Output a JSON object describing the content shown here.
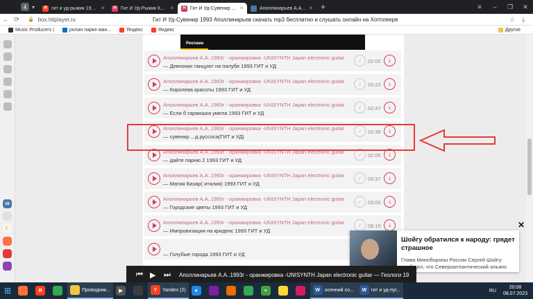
{
  "browser": {
    "tab_count": "4",
    "tabs": [
      {
        "label": "гит и уд-рыжик 1993 аппо",
        "fav_color": "#fc3f1d",
        "fav_text": "Я"
      },
      {
        "label": "Гит И Уд-Рыжик Классно",
        "fav_color": "#d43c5c",
        "fav_text": "H"
      },
      {
        "label": "Гит И Уд-Сувенир 1993",
        "fav_color": "#d43c5c",
        "fav_text": "H",
        "active": true
      },
      {
        "label": "Аполлинарьев А.А..1993г",
        "fav_color": "#4a76a8",
        "fav_text": ""
      }
    ],
    "url": "box.hitplayer.ru",
    "page_title": "Гит И Уд-Сувенир 1993 Аполлинарьев скачать mp3 бесплатно и слушать онлайн на Хотплеере",
    "bookmarks": [
      {
        "label": "Music Producers |",
        "color": "#333333"
      },
      {
        "label": "ролан парке ман...",
        "color": "#0070c0"
      },
      {
        "label": "Яндекс",
        "color": "#fc3f1d"
      },
      {
        "label": "Яндекс",
        "color": "#fc3f1d"
      }
    ],
    "bookmarks_other": "Другое"
  },
  "ad": {
    "label": "Реклама"
  },
  "tracks": [
    {
      "artist": "Аполлинарьев А.А..1993г - оранжировка -UNISYNTH Japan electronic guitar",
      "title": "— Девчонки танцуют на палубе 1993 ГИТ и УД",
      "duration": "02:00"
    },
    {
      "artist": "Аполлинарьев А.А..1993г - оранжировка -UNISYNTH Japan electronic guitar",
      "title": "— Королева красоты 1993 ГИТ и УД",
      "duration": "03:22"
    },
    {
      "artist": "Аполлинарьев А.А..1993г - оранжировка -UNISYNTH Japan electronic guitar",
      "title": "— Если б гармошка умела 1993 ГИТ и УД",
      "duration": "02:47"
    },
    {
      "artist": "Аполлинарьев А.А..1993г - оранжировка -UNISYNTH Japan electronic guitar",
      "title": "— сувенир ...д.руссоса(ГИТ и УД)",
      "duration": "03:36"
    },
    {
      "artist": "Аполлинарьев А.А..1993г - оранжировка -UNISYNTH Japan electronic guitar",
      "title": "— дайте парню 2 1993 ГИТ и УД",
      "duration": "02:05"
    },
    {
      "artist": "Аполлинарьев А.А..1993г - оранжировка -UNISYNTH Japan electronic guitar",
      "title": "— Матия Базар( италия) 1993 ГИТ и УД",
      "duration": "03:37"
    },
    {
      "artist": "Аполлинарьев А.А..1993г - оранжировка -UNISYNTH Japan electronic guitar",
      "title": "— Городские цветы 1993 ГИТ и УД",
      "duration": "03:00"
    },
    {
      "artist": "Аполлинарьев А.А..1993г - оранжировка -UNISYNTH Japan electronic guitar",
      "title": "— Импровизация на криденс 1993 ГИТ и УД",
      "duration": "06:15"
    },
    {
      "artist": "",
      "title": "— Голубые города 1993 ГИТ и УД",
      "duration": ""
    }
  ],
  "notification": {
    "title": "Шойгу обратился к народу: грядет страшное",
    "text": "Глава Минобороны России Сергей Шойгу сообщил, что Североатлантический альянс"
  },
  "player": {
    "now_playing": "Аполлинарьев А.А..1993г - оранжировка -UNISYNTH Japan electronic guitar — Геологи 19"
  },
  "taskbar": {
    "items": [
      {
        "label": "Проводник...",
        "color": "#f4c542",
        "icon": ""
      },
      {
        "label": "Yandex (2)",
        "color": "#fc3f1d",
        "icon": "Y"
      },
      {
        "label": "осенний со...",
        "color": "#2b579a",
        "icon": "W"
      },
      {
        "label": "гит и уд-пуг...",
        "color": "#2b579a",
        "icon": "W"
      }
    ],
    "lang": "RU",
    "time": "20:08",
    "date": "08.07.2023"
  }
}
